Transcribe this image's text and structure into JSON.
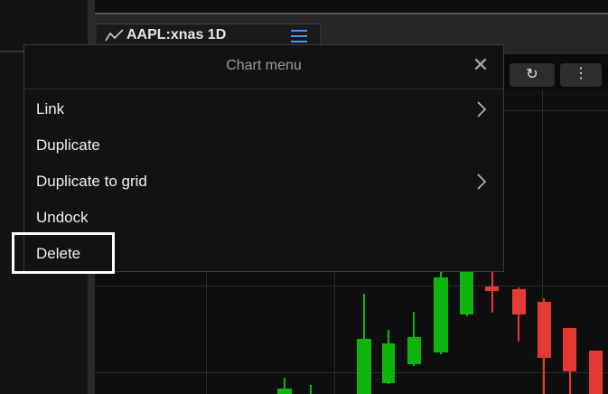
{
  "tab": {
    "title": "AAPL:xnas 1D",
    "icon": "line-chart-icon",
    "menu_icon": "hamburger-icon",
    "accent": "#4a8eff"
  },
  "toolbar": {
    "sync_icon": "sync-icon",
    "more_icon": "more-vertical-icon",
    "sync_glyph": "↻",
    "more_glyph": "⋮"
  },
  "menu": {
    "title": "Chart menu",
    "close_glyph": "✕",
    "items": [
      {
        "label": "Link",
        "has_submenu": true
      },
      {
        "label": "Duplicate",
        "has_submenu": false
      },
      {
        "label": "Duplicate to grid",
        "has_submenu": true
      },
      {
        "label": "Undock",
        "has_submenu": false
      },
      {
        "label": "Delete",
        "has_submenu": false,
        "highlighted": true
      }
    ]
  },
  "colors": {
    "up": "#0fb40f",
    "down": "#e53935",
    "background": "#0b0b0b"
  }
}
